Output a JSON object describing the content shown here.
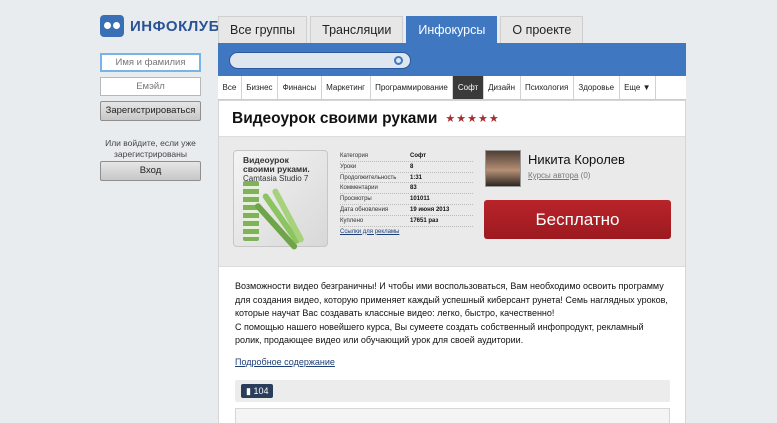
{
  "brand": {
    "logo_text": "ИНФОКЛУБ",
    "accent": "#3f78c0",
    "buy_color": "#a81f24"
  },
  "login": {
    "name_placeholder": "Имя и фамилия",
    "email_placeholder": "Емэйл",
    "register_label": "Зарегистрироваться",
    "hint": "Или войдите, если уже зарегистрированы",
    "login_label": "Вход"
  },
  "tabs": [
    {
      "label": "Все группы"
    },
    {
      "label": "Трансляции"
    },
    {
      "label": "Инфокурсы",
      "active": true
    },
    {
      "label": "О проекте"
    }
  ],
  "categories": [
    {
      "label": "Все"
    },
    {
      "label": "Бизнес"
    },
    {
      "label": "Финансы"
    },
    {
      "label": "Маркетинг"
    },
    {
      "label": "Программирование"
    },
    {
      "label": "Софт",
      "active": true
    },
    {
      "label": "Дизайн"
    },
    {
      "label": "Психология"
    },
    {
      "label": "Здоровье"
    },
    {
      "label": "Еще ▼"
    }
  ],
  "course": {
    "title": "Видеоурок своими руками",
    "rating": 4.5,
    "stars": "★★★★★",
    "cover": {
      "line1": "Видеоурок",
      "line2": "своими руками.",
      "line3": "Camtasia Studio 7"
    },
    "meta": [
      {
        "k": "Категория",
        "v": "Софт"
      },
      {
        "k": "Уроки",
        "v": "8"
      },
      {
        "k": "Продолжительность",
        "v": "1:31"
      },
      {
        "k": "Комментарии",
        "v": "83"
      },
      {
        "k": "Просмотры",
        "v": "101011"
      },
      {
        "k": "Дата обновления",
        "v": "19 июня 2013"
      },
      {
        "k": "Куплено",
        "v": "17651 раз"
      }
    ],
    "ad_link": "Ссылки для рекламы",
    "author": {
      "name": "Никита Королев",
      "courses_label": "Курсы автора",
      "courses_count": "(0)"
    },
    "buy_label": "Бесплатно",
    "description": [
      "Возможности видео безграничны! И чтобы ими воспользоваться, Вам необходимо освоить программу для создания видео, которую применяет каждый успешный киберсант рунета! Семь наглядных уроков, которые научат Вас создавать классные видео: легко, быстро, качественно!",
      "С помощью нашего новейшего курса, Вы сумеете создать собственный инфопродукт, рекламный ролик, продающее видео или обучающий урок для своей аудитории."
    ],
    "more_link": "Подробное содержание",
    "views": "104"
  }
}
